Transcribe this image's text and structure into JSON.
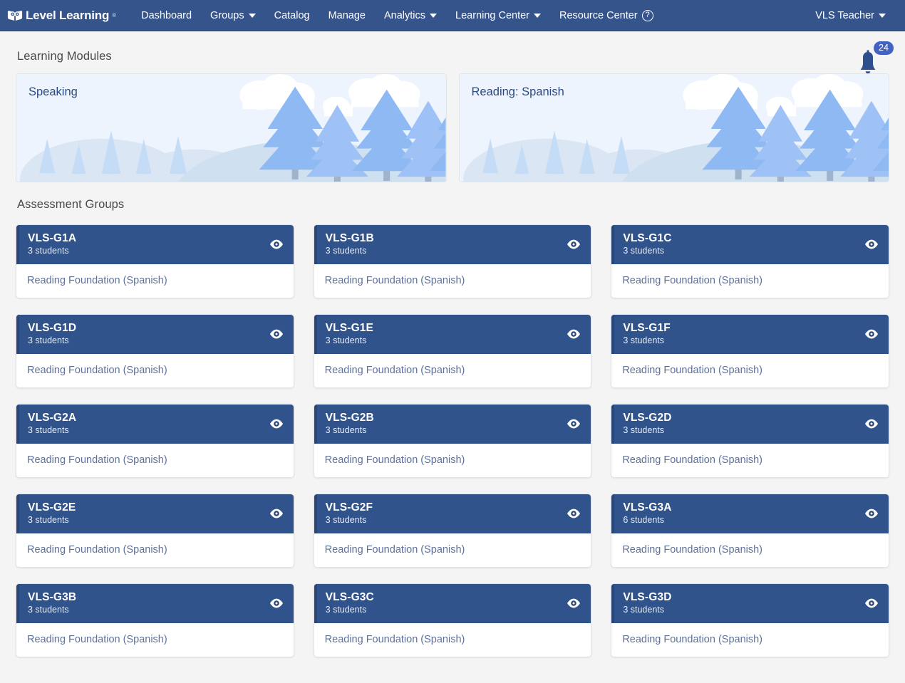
{
  "navbar": {
    "brand": "Level Learning",
    "brand_icon": "owl-book-logo",
    "trademark": "®",
    "links": [
      {
        "label": "Dashboard",
        "has_caret": false,
        "has_help": false
      },
      {
        "label": "Groups",
        "has_caret": true,
        "has_help": false
      },
      {
        "label": "Catalog",
        "has_caret": false,
        "has_help": false
      },
      {
        "label": "Manage",
        "has_caret": false,
        "has_help": false
      },
      {
        "label": "Analytics",
        "has_caret": true,
        "has_help": false
      },
      {
        "label": "Learning Center",
        "has_caret": true,
        "has_help": false
      },
      {
        "label": "Resource Center",
        "has_caret": false,
        "has_help": true
      }
    ],
    "user_menu": "VLS Teacher",
    "help_glyph": "?"
  },
  "notifications": {
    "icon": "bell-icon",
    "count": "24"
  },
  "learning_modules": {
    "title": "Learning Modules",
    "cards": [
      {
        "title": "Speaking",
        "art": "forest-landscape"
      },
      {
        "title": "Reading: Spanish",
        "art": "forest-landscape"
      }
    ]
  },
  "assessment_groups": {
    "title": "Assessment Groups",
    "eye_icon": "eye-icon",
    "cards": [
      {
        "name": "VLS-G1A",
        "students": "3 students",
        "module": "Reading Foundation (Spanish)"
      },
      {
        "name": "VLS-G1B",
        "students": "3 students",
        "module": "Reading Foundation (Spanish)"
      },
      {
        "name": "VLS-G1C",
        "students": "3 students",
        "module": "Reading Foundation (Spanish)"
      },
      {
        "name": "VLS-G1D",
        "students": "3 students",
        "module": "Reading Foundation (Spanish)"
      },
      {
        "name": "VLS-G1E",
        "students": "3 students",
        "module": "Reading Foundation (Spanish)"
      },
      {
        "name": "VLS-G1F",
        "students": "3 students",
        "module": "Reading Foundation (Spanish)"
      },
      {
        "name": "VLS-G2A",
        "students": "3 students",
        "module": "Reading Foundation (Spanish)"
      },
      {
        "name": "VLS-G2B",
        "students": "3 students",
        "module": "Reading Foundation (Spanish)"
      },
      {
        "name": "VLS-G2D",
        "students": "3 students",
        "module": "Reading Foundation (Spanish)"
      },
      {
        "name": "VLS-G2E",
        "students": "3 students",
        "module": "Reading Foundation (Spanish)"
      },
      {
        "name": "VLS-G2F",
        "students": "3 students",
        "module": "Reading Foundation (Spanish)"
      },
      {
        "name": "VLS-G3A",
        "students": "6 students",
        "module": "Reading Foundation (Spanish)"
      },
      {
        "name": "VLS-G3B",
        "students": "3 students",
        "module": "Reading Foundation (Spanish)"
      },
      {
        "name": "VLS-G3C",
        "students": "3 students",
        "module": "Reading Foundation (Spanish)"
      },
      {
        "name": "VLS-G3D",
        "students": "3 students",
        "module": "Reading Foundation (Spanish)"
      }
    ]
  },
  "colors": {
    "navbar": "#36548c",
    "card_header": "#31538c",
    "badge": "#4262c4",
    "module_bg": "#eef4fd",
    "module_title": "#2b4a86",
    "module_link": "#5e719b",
    "page_bg": "#f4f4f5"
  }
}
